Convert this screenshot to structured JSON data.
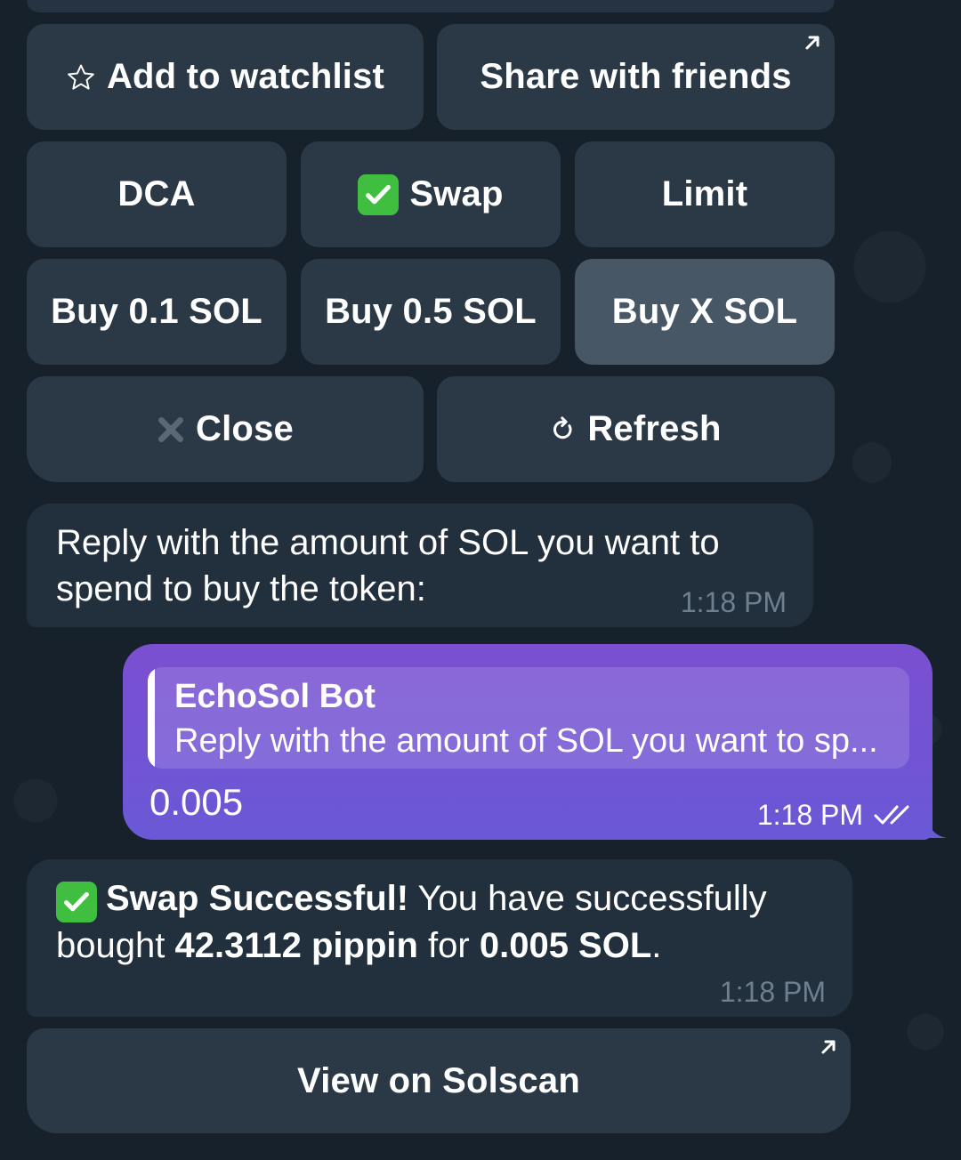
{
  "keyboard": {
    "row1": [
      {
        "icon": "star-outline-icon",
        "label": "Add to watchlist"
      },
      {
        "label": "Share with friends",
        "icon": "external-arrow-icon"
      }
    ],
    "row2": [
      {
        "label": "DCA"
      },
      {
        "icon": "check-mark-emoji-icon",
        "label": "Swap"
      },
      {
        "label": "Limit"
      }
    ],
    "row3": [
      {
        "label": "Buy 0.1 SOL"
      },
      {
        "label": "Buy 0.5 SOL"
      },
      {
        "label": "Buy X SOL",
        "state": "pressed"
      }
    ],
    "row4": [
      {
        "icon": "cross-mark-icon",
        "label": "Close"
      },
      {
        "icon": "refresh-icon",
        "label": "Refresh"
      }
    ]
  },
  "messages": [
    {
      "direction": "incoming",
      "text_line1": "Reply with the amount of SOL you want to",
      "text_line2": "spend to buy the token:",
      "time": "1:18 PM"
    },
    {
      "direction": "outgoing",
      "reply_to_name": "EchoSol Bot",
      "reply_to_text": "Reply with the amount of SOL you want to sp...",
      "text": "0.005",
      "time": "1:18 PM",
      "status_icon": "double-check-read-icon"
    },
    {
      "direction": "incoming",
      "icon": "check-mark-emoji-icon",
      "bold_title": "Swap Successful!",
      "text_part1": " You have successfully",
      "text_part2": "bought ",
      "amount_token": "42.3112 pippin",
      "text_part3": " for ",
      "amount_sol": "0.005 SOL",
      "text_part4": ".",
      "time": "1:18 PM",
      "button": {
        "label": "View on Solscan",
        "icon": "external-arrow-icon"
      }
    }
  ],
  "colors": {
    "background": "#17212b",
    "button": "#2b3947",
    "button_pressed": "#485766",
    "incoming_bubble": "#22303e",
    "outgoing_bubble": "#7152d3",
    "check_green": "#3fbe3f",
    "timestamp": "#6e808f"
  }
}
